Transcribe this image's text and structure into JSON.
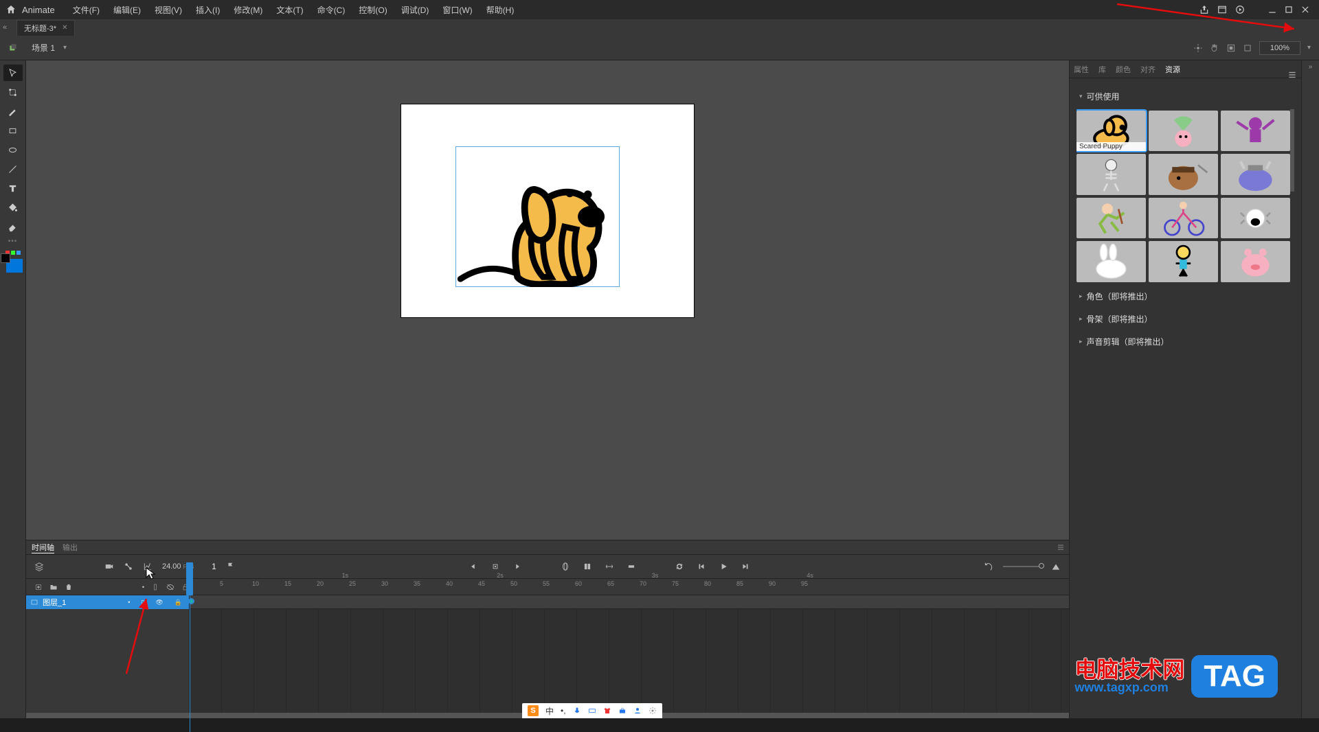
{
  "app_name": "Animate",
  "menu": [
    "文件(F)",
    "编辑(E)",
    "视图(V)",
    "插入(I)",
    "修改(M)",
    "文本(T)",
    "命令(C)",
    "控制(O)",
    "调试(D)",
    "窗口(W)",
    "帮助(H)"
  ],
  "document_tab": {
    "title": "无标题-3*",
    "closeable": true
  },
  "scene": {
    "name": "场景 1",
    "zoom": "100%"
  },
  "timeline": {
    "tabs": [
      "时间轴",
      "输出"
    ],
    "active_tab": "时间轴",
    "fps": "24.00",
    "fps_label": "FPS",
    "current_frame": "1",
    "layer_name": "图层_1",
    "ruler_ticks": [
      5,
      10,
      15,
      20,
      25,
      30,
      35,
      40,
      45,
      50,
      55,
      60,
      65,
      70,
      75,
      80,
      85,
      90,
      95
    ],
    "second_marks": [
      "1s",
      "2s",
      "3s",
      "4s"
    ]
  },
  "right_panel": {
    "tabs": [
      "属性",
      "库",
      "颜色",
      "对齐",
      "资源"
    ],
    "active_tab": "资源",
    "sections": {
      "available": "可供使用",
      "roles": "角色（即将推出）",
      "rigs": "骨架（即将推出）",
      "audio": "声音剪辑（即将推出）"
    },
    "selected_asset_label": "Scared Puppy",
    "asset_names": [
      "scared-puppy",
      "parachute-pig",
      "ninja",
      "skeleton",
      "pirate-potato",
      "viking-hippo",
      "grandpa-run",
      "girl-bike",
      "shout",
      "bunny",
      "stick-kid",
      "pink-pig"
    ]
  },
  "watermark": {
    "text": "电脑技术网",
    "url": "www.tagxp.com",
    "badge": "TAG"
  },
  "ime": {
    "lang_label": "中"
  }
}
